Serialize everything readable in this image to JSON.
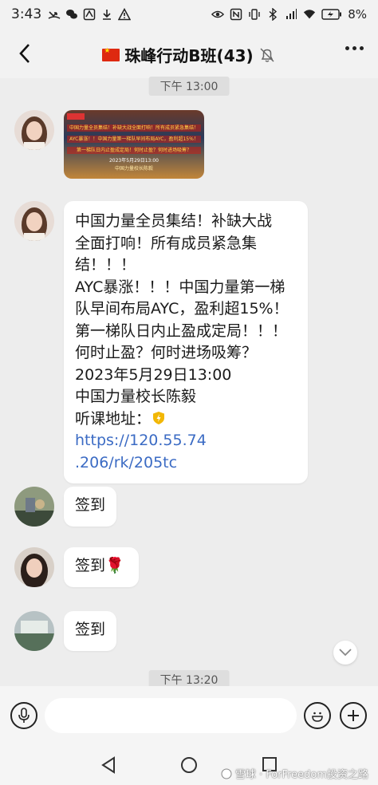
{
  "status_bar": {
    "time": "3:43",
    "battery": "8%"
  },
  "header": {
    "title": "珠峰行动B班(43)",
    "back_icon": "chevron-left-icon",
    "mute_icon": "bell-off-icon",
    "more_icon": "more-dots-icon"
  },
  "chat": {
    "time_1": "下午 13:00",
    "image_lines": [
      "中国力量全员集结！补缺大战全面打响！所有成员紧急集结！",
      "AYC暴涨！！中国力量第一梯队早间布局AYC，盈利超15%！",
      "第一梯队日内止盈成定局！何时止盈？何时进场吸筹？",
      "2023年5月29日13:00",
      "中国力量校长陈毅"
    ],
    "message_lines": [
      "中国力量全员集结！补缺大战",
      "全面打响！所有成员紧急集",
      "结！！！",
      "AYC暴涨！！！中国力量第一梯",
      "队早间布局AYC，盈利超15%！",
      "第一梯队日内止盈成定局！！！",
      "何时止盈？何时进场吸筹？",
      "2023年5月29日13:00",
      "中国力量校长陈毅"
    ],
    "link_label": "听课地址：",
    "link_part1": "https://120.55.74",
    "link_part2": ".206/rk/205tc",
    "checkin_1": "签到",
    "checkin_2": "签到",
    "checkin_2_emoji": "🌹",
    "checkin_3": "签到",
    "time_2": "下午 13:20"
  },
  "input_bar": {
    "voice_icon": "microphone-icon",
    "emoji_icon": "emoji-icon",
    "plus_icon": "plus-icon"
  },
  "watermark": "雪球 · ForFreedom投资之路"
}
